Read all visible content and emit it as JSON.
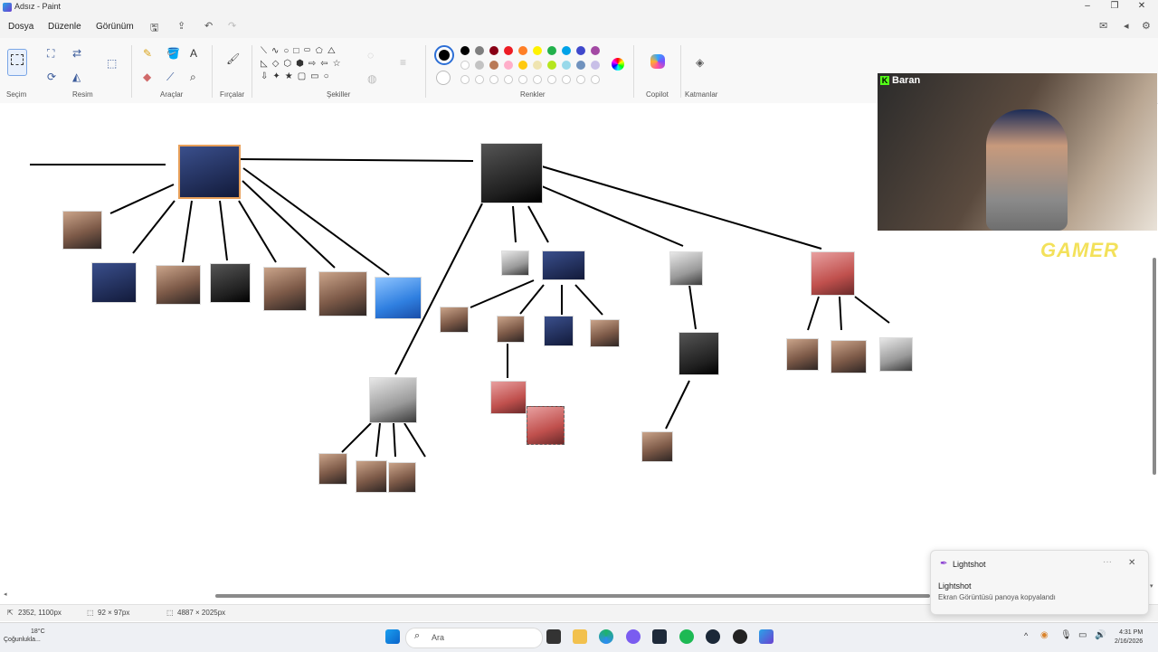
{
  "window": {
    "title": "Adsız - Paint"
  },
  "menu": [
    "Dosya",
    "Düzenle",
    "Görünüm"
  ],
  "ribbon": {
    "groups": [
      "Seçim",
      "Resim",
      "Araçlar",
      "Fırçalar",
      "Şekiller",
      "Renkler",
      "Copilot",
      "Katmanlar"
    ]
  },
  "palette": {
    "row1": [
      "#000000",
      "#7f7f7f",
      "#880015",
      "#ed1c24",
      "#ff7f27",
      "#fff200",
      "#22b14c",
      "#00a2e8",
      "#3f48cc",
      "#a349a4"
    ],
    "row2": [
      "#ffffff",
      "#c3c3c3",
      "#b97a57",
      "#ffaec9",
      "#ffc90e",
      "#efe4b0",
      "#b5e61d",
      "#99d9ea",
      "#7092be",
      "#c8bfe7"
    ]
  },
  "stream": {
    "name": "Baran",
    "overlay": "GAMER"
  },
  "status": {
    "cursor": "2352, 1100px",
    "selection": "92 × 97px",
    "canvas_size": "4887 × 2025px"
  },
  "toast": {
    "app": "Lightshot",
    "title": "Lightshot",
    "message": "Ekran Görüntüsü panoya kopyalandı"
  },
  "taskbar": {
    "search_placeholder": "Ara",
    "weather": "18°C",
    "weather_label": "Çoğunlukla...",
    "time": "4:31 PM",
    "date": "2/16/2026"
  }
}
